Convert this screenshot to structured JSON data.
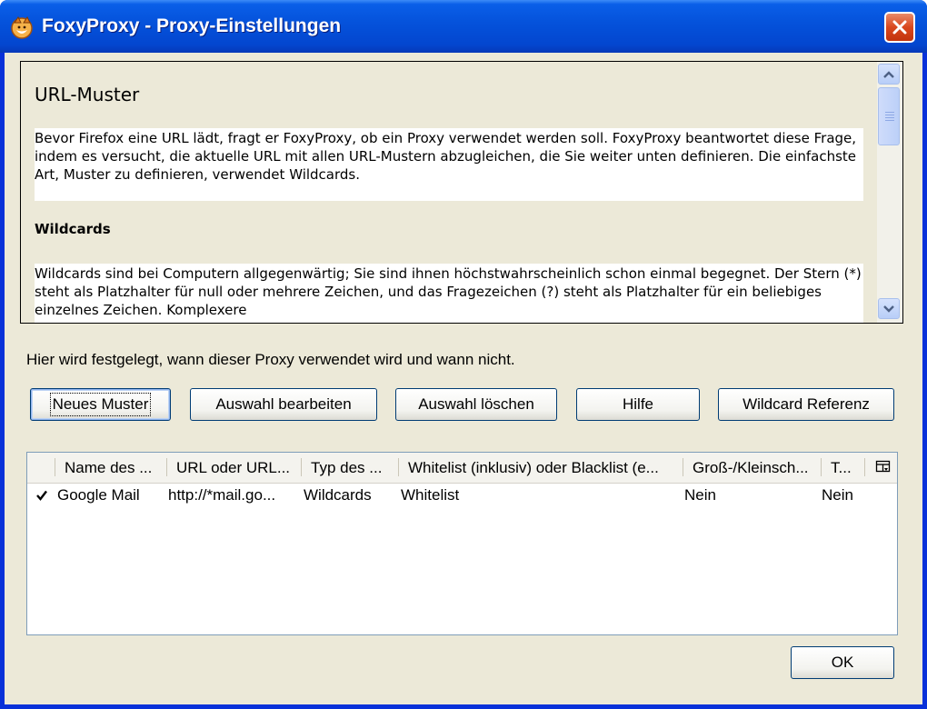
{
  "window": {
    "title": "FoxyProxy - Proxy-Einstellungen"
  },
  "help": {
    "heading": "URL-Muster",
    "paragraph1": "Bevor Firefox eine URL lädt, fragt er FoxyProxy, ob ein Proxy verwendet werden soll. FoxyProxy beantwortet diese Frage, indem es versucht, die aktuelle URL mit allen URL-Mustern abzugleichen, die Sie weiter unten definieren. Die einfachste Art, Muster zu definieren, verwendet Wildcards.",
    "subheading": "Wildcards",
    "paragraph2": "Wildcards sind bei Computern allgegenwärtig; Sie sind ihnen höchstwahrscheinlich schon einmal begegnet. Der Stern (*) steht als Platzhalter für null oder mehrere Zeichen, und das Fragezeichen (?) steht als Platzhalter für ein beliebiges einzelnes Zeichen. Komplexere"
  },
  "info_text": "Hier wird festgelegt, wann dieser Proxy verwendet wird und wann nicht.",
  "buttons": {
    "new_pattern": "Neues Muster",
    "edit": "Auswahl bearbeiten",
    "delete": "Auswahl löschen",
    "help": "Hilfe",
    "wildcard_ref": "Wildcard Referenz",
    "ok": "OK"
  },
  "table": {
    "columns": [
      "Name des ...",
      "URL oder URL...",
      "Typ des ...",
      "Whitelist (inklusiv) oder Blacklist (e...",
      "Groß-/Kleinsch...",
      "T..."
    ],
    "rows": [
      {
        "enabled": true,
        "name": "Google Mail",
        "url": "http://*mail.go...",
        "type": "Wildcards",
        "list": "Whitelist",
        "case_sensitive": "Nein",
        "temp": "Nein"
      }
    ]
  },
  "icons": {
    "app": "foxyproxy-fox-icon",
    "close": "close-icon",
    "column_picker": "column-picker-icon",
    "check": "checkmark-icon"
  },
  "colors": {
    "titlebar": "#0553dc",
    "dialog_bg": "#ece9d8",
    "close_button": "#d9471e",
    "button_border": "#003c74"
  }
}
